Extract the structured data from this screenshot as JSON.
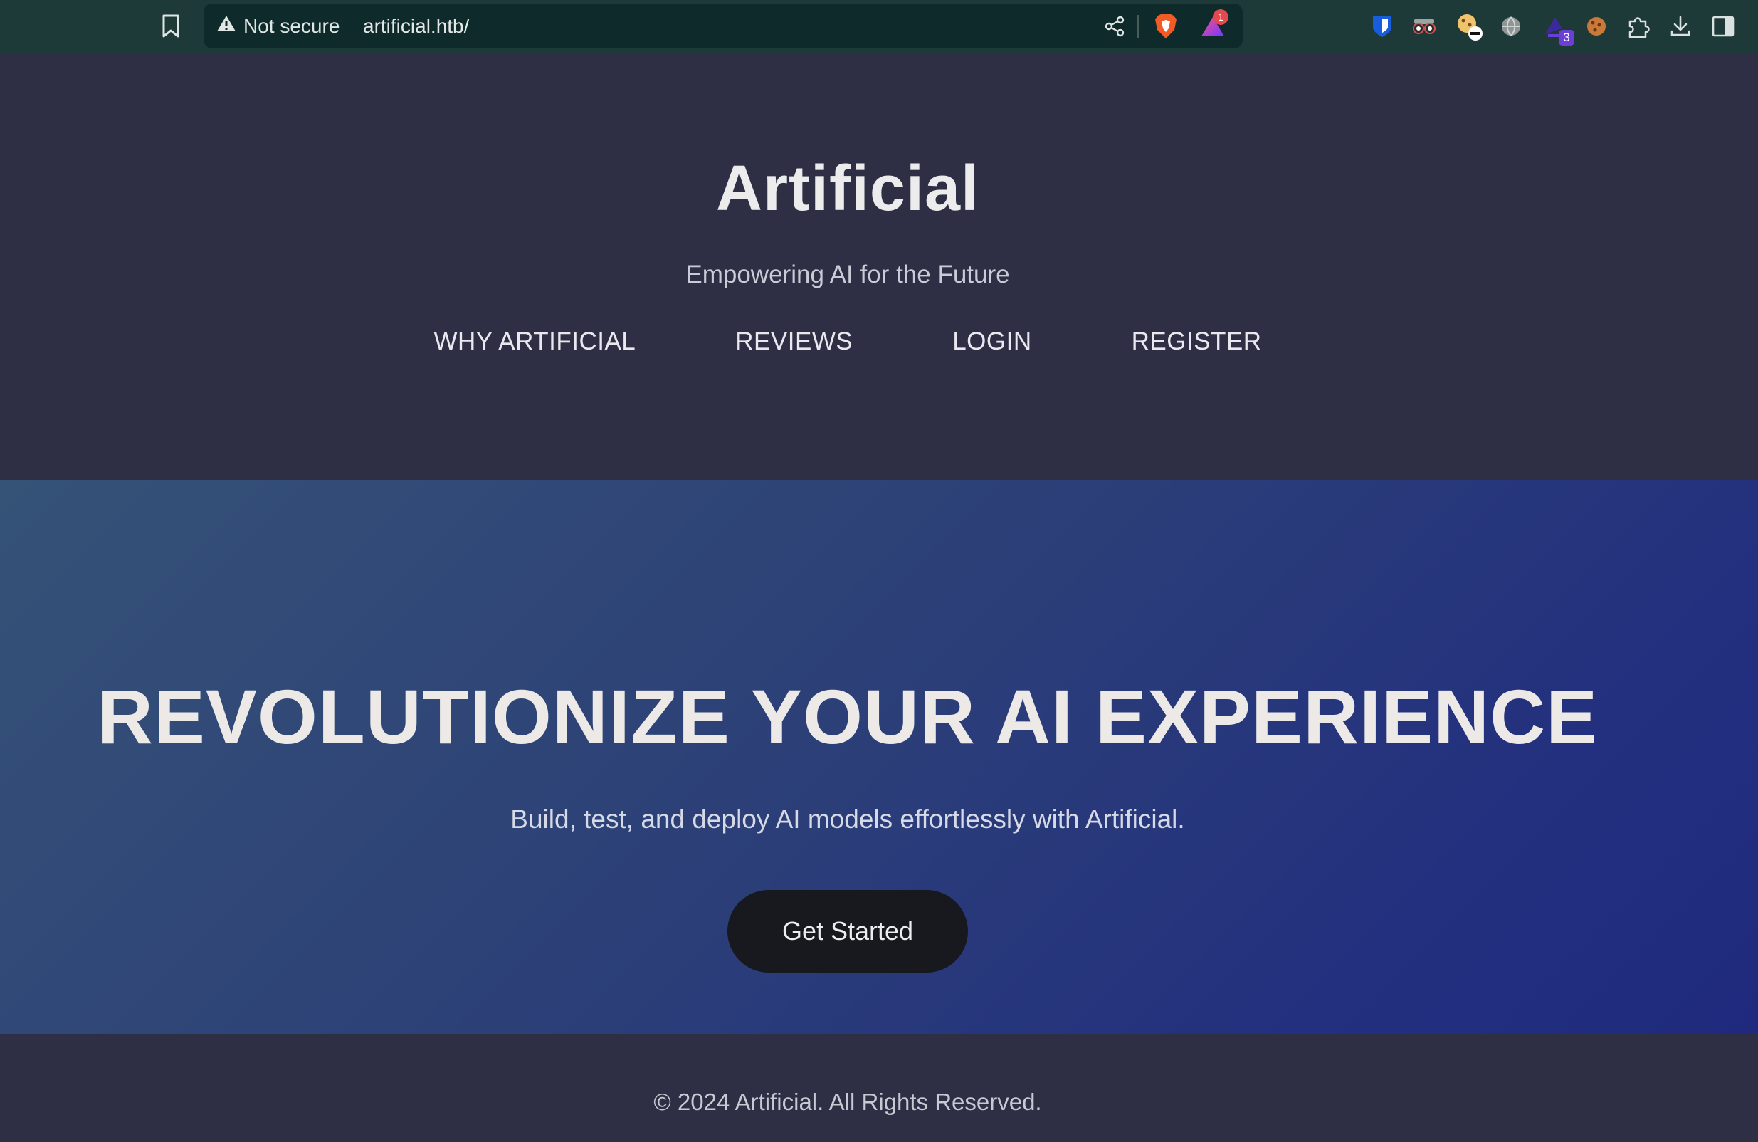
{
  "browser": {
    "security_label": "Not secure",
    "url": "artificial.htb/",
    "shield_badge": "1",
    "extensions": [
      {
        "name": "bitwarden-icon",
        "color": "#175ddc"
      },
      {
        "name": "binoculars-icon",
        "color": "#d9534f"
      },
      {
        "name": "cookie-blocker-icon",
        "color": "#f0c36d"
      },
      {
        "name": "globe-icon",
        "color": "#9a9a9a"
      },
      {
        "name": "wizard-extension-icon",
        "color": "#6b3fd6",
        "badge": "3"
      },
      {
        "name": "cookie-icon",
        "color": "#c97a3a"
      },
      {
        "name": "puzzle-icon",
        "color": "#d9e2e0"
      },
      {
        "name": "download-icon",
        "color": "#d9e2e0"
      },
      {
        "name": "sidebar-icon",
        "color": "#d9e2e0"
      }
    ]
  },
  "header": {
    "title": "Artificial",
    "subtitle": "Empowering AI for the Future",
    "nav": [
      "WHY ARTIFICIAL",
      "REVIEWS",
      "LOGIN",
      "REGISTER"
    ]
  },
  "hero": {
    "title": "REVOLUTIONIZE YOUR AI EXPERIENCE",
    "text": "Build, test, and deploy AI models effortlessly with Artificial.",
    "cta_label": "Get Started"
  },
  "footer": {
    "copyright": "© 2024 Artificial. All Rights Reserved."
  },
  "colors": {
    "page_background": "#2e2f45",
    "hero_gradient_start": "#355277",
    "hero_gradient_end": "#1f2a7e",
    "button_background": "#17191e",
    "toolbar_background": "#1e3a38"
  }
}
